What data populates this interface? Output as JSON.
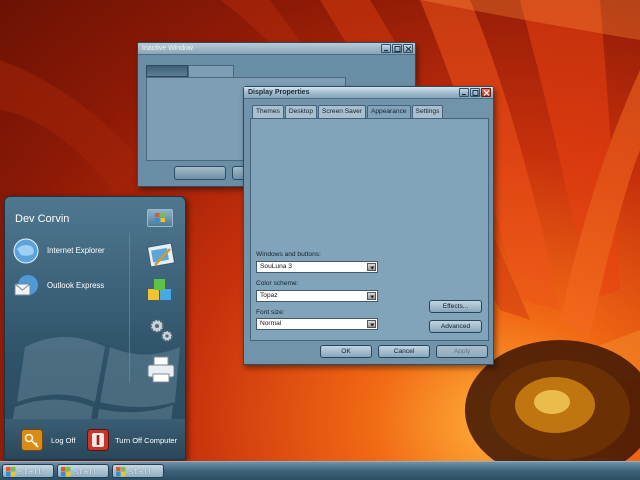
{
  "inactive_window": {
    "title": "Inactive Window"
  },
  "display_properties": {
    "title": "Display Properties",
    "tabs": [
      "Themes",
      "Desktop",
      "Screen Saver",
      "Appearance",
      "Settings"
    ],
    "active_tab": "Appearance",
    "windows_label": "Windows and buttons:",
    "windows_value": "SouLuna 3",
    "scheme_label": "Color scheme:",
    "scheme_value": "Topaz",
    "font_label": "Font size:",
    "font_value": "Normal",
    "effects_label": "Effects...",
    "advanced_label": "Advanced",
    "ok_label": "OK",
    "cancel_label": "Cancel",
    "apply_label": "Apply"
  },
  "start_menu": {
    "user": "Dev Corvin",
    "items": [
      {
        "label": "Internet Explorer",
        "icon": "internet-explorer-icon"
      },
      {
        "label": "Outlook Express",
        "icon": "outlook-express-icon"
      }
    ],
    "right_icons": [
      "paint-icon",
      "cubes-icon",
      "gears-icon",
      "printer-icon"
    ],
    "logoff_label": "Log Off",
    "turnoff_label": "Turn Off Computer"
  },
  "taskbar": {
    "start_labels": [
      "start",
      "start",
      "start"
    ]
  },
  "colors": {
    "window_blue": "#7194ab",
    "titlebar": "#9eb9cb",
    "close_red": "#b3301d",
    "wallpaper": "#c8300c"
  }
}
